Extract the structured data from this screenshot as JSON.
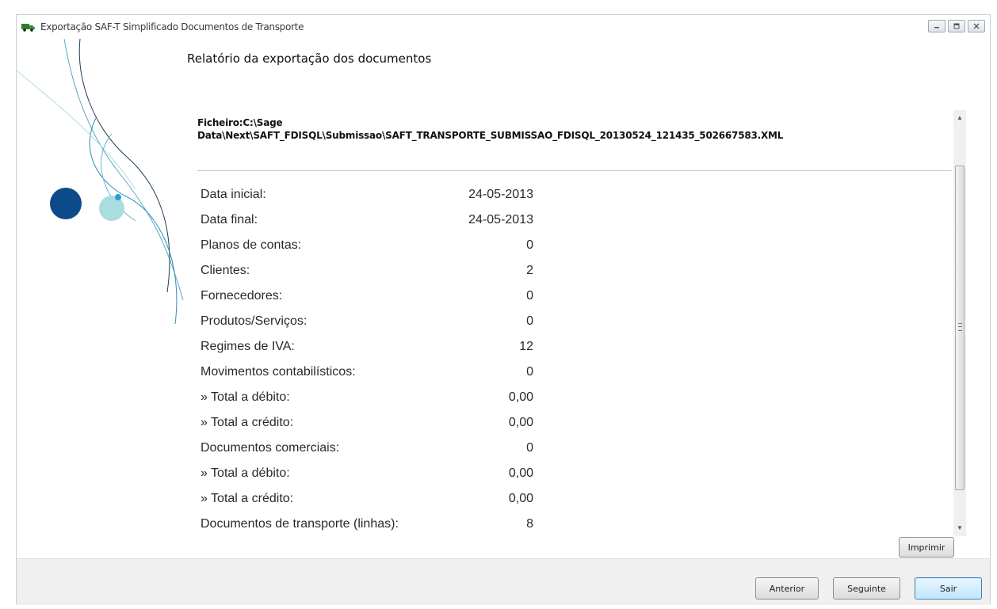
{
  "window": {
    "title": "Exportação SAF-T Simplificado Documentos de Transporte",
    "accent_color": "#1b4f8c",
    "controls": [
      "minimize-icon",
      "maximize-icon",
      "close-icon"
    ]
  },
  "report": {
    "heading": "Relatório da exportação dos documentos",
    "file_line1": "Ficheiro:C:\\Sage",
    "file_line2": "Data\\Next\\SAFT_FDISQL\\Submissao\\SAFT_TRANSPORTE_SUBMISSAO_FDISQL_20130524_121435_502667583.XML",
    "rows": [
      {
        "label": "Data inicial:",
        "value": "24-05-2013"
      },
      {
        "label": "Data final:",
        "value": "24-05-2013"
      },
      {
        "label": "Planos de contas:",
        "value": "0"
      },
      {
        "label": "Clientes:",
        "value": "2"
      },
      {
        "label": "Fornecedores:",
        "value": "0"
      },
      {
        "label": "Produtos/Serviços:",
        "value": "0"
      },
      {
        "label": "Regimes de IVA:",
        "value": "12"
      },
      {
        "label": "Movimentos contabilísticos:",
        "value": "0"
      },
      {
        "label": "» Total a débito:",
        "value": "0,00"
      },
      {
        "label": "» Total a crédito:",
        "value": "0,00"
      },
      {
        "label": "Documentos comerciais:",
        "value": "0"
      },
      {
        "label": "» Total a débito:",
        "value": "0,00"
      },
      {
        "label": "» Total a crédito:",
        "value": "0,00"
      },
      {
        "label": "Documentos de transporte (linhas):",
        "value": "8"
      }
    ]
  },
  "buttons": {
    "print": "Imprimir",
    "previous": "Anterior",
    "next": "Seguinte",
    "exit": "Sair"
  }
}
